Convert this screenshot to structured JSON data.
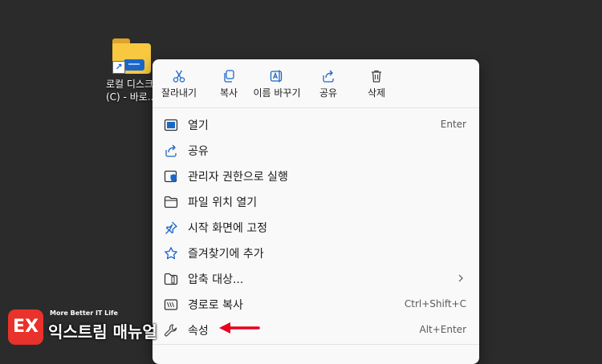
{
  "desktop": {
    "shortcut_label_line1": "로컬 디스크",
    "shortcut_label_line2": "(C) - 바로..."
  },
  "toolbar": {
    "cut_label": "잘라내기",
    "copy_label": "복사",
    "rename_label": "이름 바꾸기",
    "share_label": "공유",
    "delete_label": "삭제"
  },
  "menu": {
    "items": [
      {
        "label": "열기",
        "shortcut": "Enter",
        "icon": "open-icon"
      },
      {
        "label": "공유",
        "shortcut": "",
        "icon": "share-icon"
      },
      {
        "label": "관리자 권한으로 실행",
        "shortcut": "",
        "icon": "run-as-admin-icon"
      },
      {
        "label": "파일 위치 열기",
        "shortcut": "",
        "icon": "folder-icon"
      },
      {
        "label": "시작 화면에 고정",
        "shortcut": "",
        "icon": "pin-icon"
      },
      {
        "label": "즐겨찾기에 추가",
        "shortcut": "",
        "icon": "star-icon"
      },
      {
        "label": "압축 대상...",
        "shortcut": "",
        "icon": "archive-icon",
        "submenu": true
      },
      {
        "label": "경로로 복사",
        "shortcut": "Ctrl+Shift+C",
        "icon": "copy-path-icon"
      },
      {
        "label": "속성",
        "shortcut": "Alt+Enter",
        "icon": "wrench-icon"
      }
    ]
  },
  "watermark": {
    "logo": "EX",
    "tagline": "More Better IT Life",
    "brand": "익스트림 매뉴얼"
  },
  "colors": {
    "accent": "#1a67c9",
    "annotation": "#e8001c",
    "menu_bg": "#f9f9f9",
    "desktop_bg": "#2b2b2b"
  }
}
